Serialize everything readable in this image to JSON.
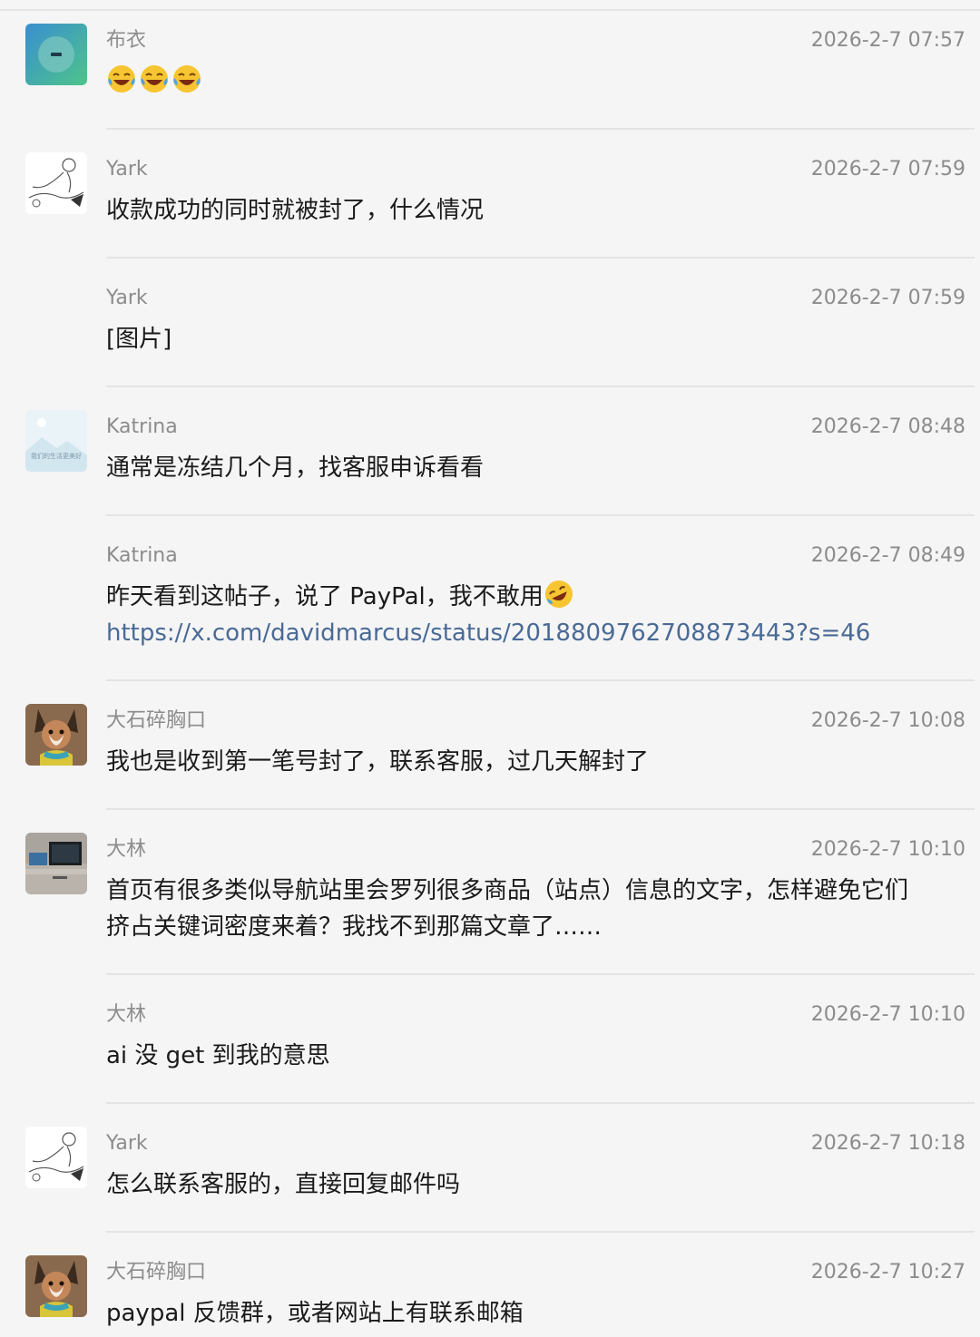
{
  "messages": [
    {
      "sender": "布衣",
      "time": "2026-2-7 07:57",
      "lines": [],
      "emojis": [
        "laughing-tears-icon",
        "laughing-tears-icon",
        "laughing-tears-icon"
      ],
      "avatar": "buyi"
    },
    {
      "sender": "Yark",
      "time": "2026-2-7 07:59",
      "lines": [
        "收款成功的同时就被封了，什么情况"
      ],
      "avatar": "yark"
    },
    {
      "sender": "Yark",
      "time": "2026-2-7 07:59",
      "lines": [
        "[图片]"
      ],
      "avatar": null
    },
    {
      "sender": "Katrina",
      "time": "2026-2-7 08:48",
      "lines": [
        "通常是冻结几个月，找客服申诉看看"
      ],
      "avatar": "katrina"
    },
    {
      "sender": "Katrina",
      "time": "2026-2-7 08:49",
      "lines": [
        "昨天看到这帖子，说了 PayPal，我不敢用"
      ],
      "link": "https://x.com/davidmarcus/status/2018809762708873443?s=46",
      "avatar": null
    },
    {
      "sender": "大石碎胸口",
      "time": "2026-2-7 10:08",
      "lines": [
        "我也是收到第一笔号封了，联系客服，过几天解封了"
      ],
      "avatar": "fox"
    },
    {
      "sender": "大林",
      "time": "2026-2-7 10:10",
      "lines": [
        "首页有很多类似导航站里会罗列很多商品（站点）信息的文字，怎样避免它们",
        "挤占关键词密度来着？我找不到那篇文章了……"
      ],
      "avatar": "dalin"
    },
    {
      "sender": "大林",
      "time": "2026-2-7 10:10",
      "lines": [
        "ai 没 get 到我的意思"
      ],
      "avatar": null
    },
    {
      "sender": "Yark",
      "time": "2026-2-7 10:18",
      "lines": [
        "怎么联系客服的，直接回复邮件吗"
      ],
      "avatar": "yark"
    },
    {
      "sender": "大石碎胸口",
      "time": "2026-2-7 10:27",
      "lines": [
        "paypal 反馈群，或者网站上有联系邮箱"
      ],
      "avatar": "fox"
    }
  ],
  "avatar_image_text": "我们的生活更美好",
  "colors": {
    "background": "#f5f5f5",
    "divider": "#e4e4e4",
    "meta_text": "#8c8c8c",
    "body_text": "#1a1a1a",
    "link": "#4a6a96"
  }
}
